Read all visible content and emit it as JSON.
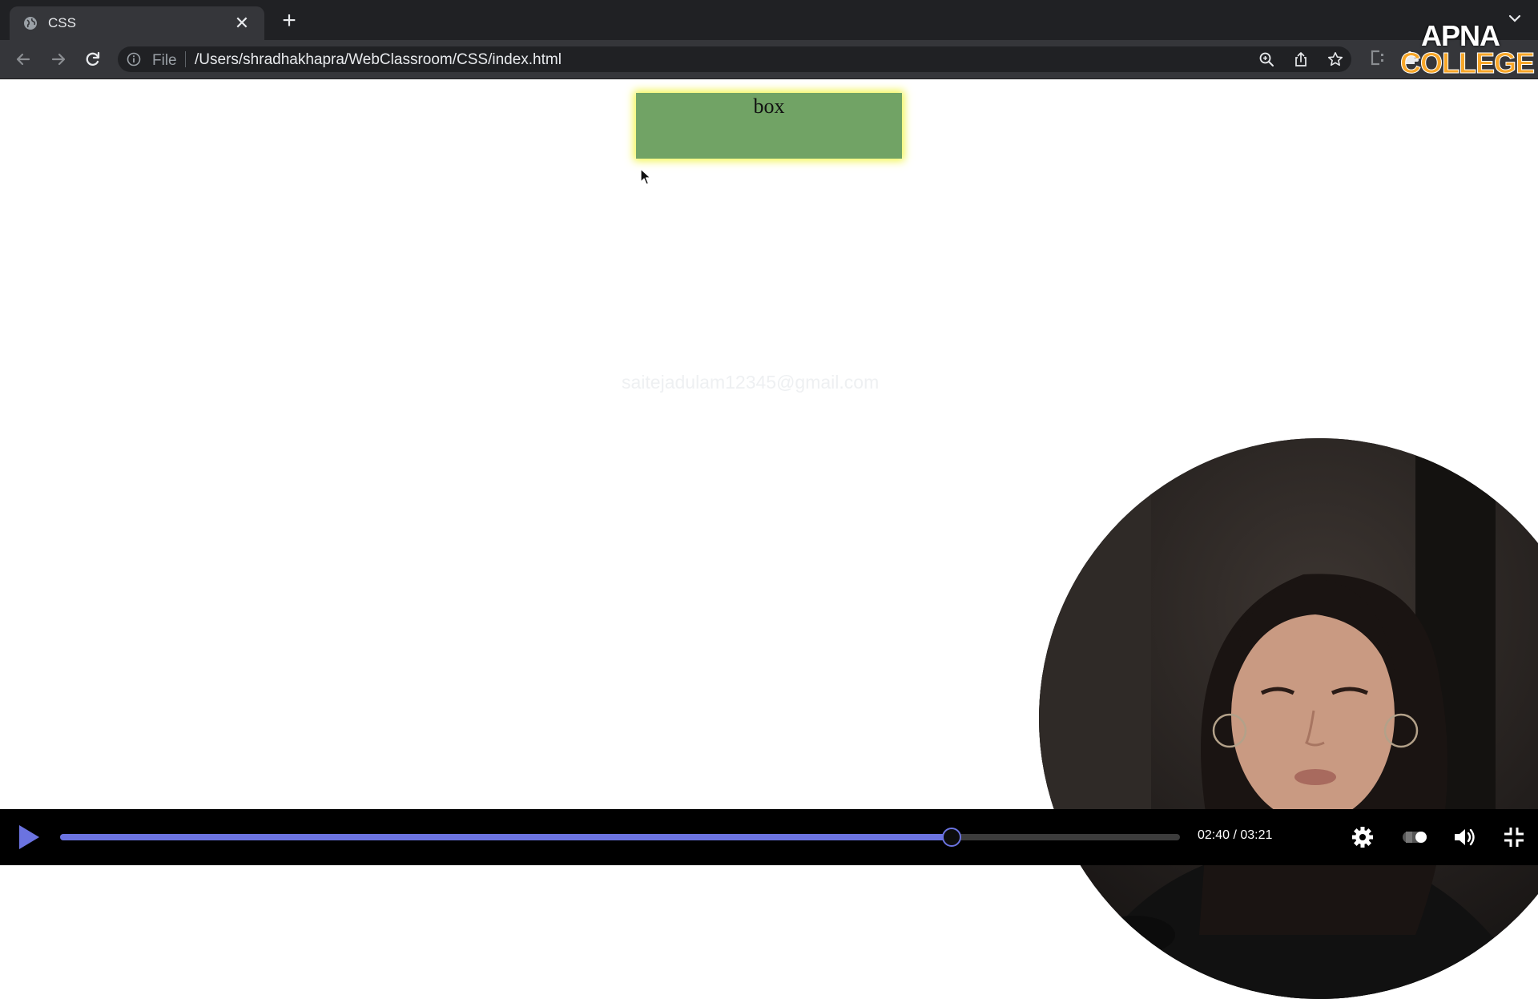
{
  "browser": {
    "tab": {
      "title": "CSS",
      "close_label": "✕"
    },
    "new_tab_label": "+",
    "omnibox": {
      "scheme_label": "File",
      "url": "/Users/shradhakhapra/WebClassroom/CSS/index.html"
    }
  },
  "logo": {
    "top": "APNA",
    "bottom": "COLLEGE"
  },
  "page": {
    "box_text": "box",
    "watermark": "saitejadulam12345@gmail.com",
    "colors": {
      "box_fill": "#71a365",
      "box_glow": "#f2f54d",
      "background": "#ffffff"
    }
  },
  "player": {
    "time_display": "02:40 / 03:21",
    "current_time": "02:40",
    "duration": "03:21",
    "progress_fraction": 0.796,
    "accent_color": "#6b73e0",
    "icons": [
      "play-icon",
      "settings-icon",
      "toggle-icon",
      "volume-icon",
      "exit-fullscreen-icon"
    ]
  }
}
